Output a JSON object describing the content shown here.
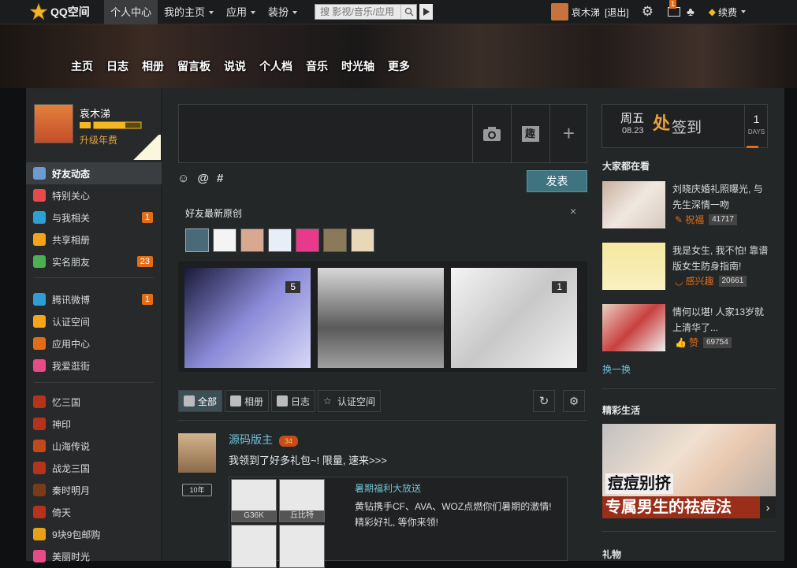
{
  "topbar": {
    "logo_text": "QQ空间",
    "nav": [
      {
        "label": "个人中心",
        "active": true,
        "dropdown": false
      },
      {
        "label": "我的主页",
        "active": false,
        "dropdown": true
      },
      {
        "label": "应用",
        "active": false,
        "dropdown": true
      },
      {
        "label": "装扮",
        "active": false,
        "dropdown": true
      }
    ],
    "search_placeholder": "搜 影视/音乐/应用",
    "user_name": "哀木涕",
    "logout": "[退出]",
    "mail_badge": "1",
    "renew_label": "续费"
  },
  "banner": {
    "tabs": [
      "主页",
      "日志",
      "相册",
      "留言板",
      "说说",
      "个人档",
      "音乐",
      "时光轴",
      "更多"
    ]
  },
  "profile": {
    "name": "哀木涕",
    "upgrade": "升级年费"
  },
  "sidebar": {
    "items": [
      {
        "label": "好友动态",
        "selected": true,
        "badge": ""
      },
      {
        "label": "特别关心",
        "selected": false,
        "badge": ""
      },
      {
        "label": "与我相关",
        "selected": false,
        "badge": "1"
      },
      {
        "label": "共享相册",
        "selected": false,
        "badge": ""
      },
      {
        "label": "实名朋友",
        "selected": false,
        "badge": "23"
      },
      {
        "label": "腾讯微博",
        "selected": false,
        "badge": "1"
      },
      {
        "label": "认证空间",
        "selected": false,
        "badge": ""
      },
      {
        "label": "应用中心",
        "selected": false,
        "badge": ""
      },
      {
        "label": "我爱逛街",
        "selected": false,
        "badge": ""
      },
      {
        "label": "忆三国",
        "selected": false,
        "badge": ""
      },
      {
        "label": "神印",
        "selected": false,
        "badge": ""
      },
      {
        "label": "山海传说",
        "selected": false,
        "badge": ""
      },
      {
        "label": "战龙三国",
        "selected": false,
        "badge": ""
      },
      {
        "label": "秦时明月",
        "selected": false,
        "badge": ""
      },
      {
        "label": "倚天",
        "selected": false,
        "badge": ""
      },
      {
        "label": "9块9包邮购",
        "selected": false,
        "badge": ""
      },
      {
        "label": "美丽时光",
        "selected": false,
        "badge": ""
      }
    ],
    "icon_colors": [
      "#6b9bd2",
      "#e64b4b",
      "#2e9fd3",
      "#f3a41b",
      "#4caf50",
      "#2e9fd3",
      "#f3a41b",
      "#e36d17",
      "#e64b87",
      "#b5331b",
      "#b5331b",
      "#c0491b",
      "#b5331b",
      "#7a3b1b",
      "#b5331b",
      "#e8a01b",
      "#e64b87"
    ]
  },
  "composer": {
    "publish_label": "发表",
    "emoji_glyph": "☺",
    "at_glyph": "@",
    "hash_glyph": "#"
  },
  "originals": {
    "title": "好友最新原创",
    "close": "×",
    "photo_counts": [
      "5",
      "",
      "1"
    ]
  },
  "filters": {
    "tabs": [
      "全部",
      "相册",
      "日志",
      "认证空间"
    ]
  },
  "feed": {
    "name": "源码版主",
    "text": "我领到了好多礼包~! 限量, 速来>>>",
    "years_badge": "10年",
    "card_title": "暑期福利大放送",
    "card_desc": "黄钻携手CF、AVA、WOZ点燃你们暑期的激情! 精彩好礼, 等你来领!",
    "gun_labels": [
      "G36K",
      "丘比特",
      "",
      ""
    ],
    "badge_icon": "34"
  },
  "checkin": {
    "weekday": "周五",
    "date": "08.23",
    "sign_label": "签到",
    "days_count": "1",
    "days_label": "DAYS"
  },
  "right": {
    "watching_title": "大家都在看",
    "items": [
      {
        "text": "刘晓庆婚礼照曝光, 与先生深情一吻",
        "action": "祝福",
        "count": "41717"
      },
      {
        "text": "我是女生, 我不怕! 靠谱版女生防身指南!",
        "action": "感兴趣",
        "count": "20661"
      },
      {
        "text": "情何以堪! 人家13岁就上清华了...",
        "action": "赞",
        "count": "69754"
      }
    ],
    "swap": "换一换",
    "life_title": "精彩生活",
    "life_line1": "痘痘别挤",
    "life_line2": "专属男生的祛痘法",
    "gift_title": "礼物"
  }
}
